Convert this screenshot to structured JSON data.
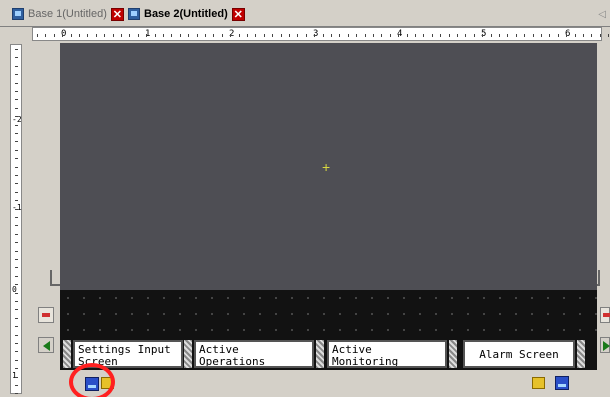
{
  "tabs": [
    {
      "label": "Base 1(Untitled)",
      "active": false
    },
    {
      "label": "Base 2(Untitled)",
      "active": true
    }
  ],
  "ruler": {
    "horizontal_numbers": [
      "0",
      "1",
      "2",
      "3",
      "4",
      "5",
      "6"
    ],
    "vertical_numbers": [
      "-2",
      "-1",
      "0",
      "1"
    ]
  },
  "screen_switches": [
    {
      "label": "Settings Input Screen"
    },
    {
      "label": "Active Operations Screen"
    },
    {
      "label": "Active Monitoring Screen"
    },
    {
      "label": "Alarm Screen"
    }
  ],
  "colors": {
    "canvas": "#4e4e54",
    "strip": "#121212",
    "highlight_circle": "#ff2020",
    "tab_close": "#c00000"
  },
  "icons": {
    "tab_document": "screen-icon",
    "tab_close": "close-icon",
    "bottom_left": "screen-icon",
    "bottom_left_folder": "folder-icon",
    "bottom_right_folder": "folder-icon",
    "bottom_right": "screen-icon"
  }
}
